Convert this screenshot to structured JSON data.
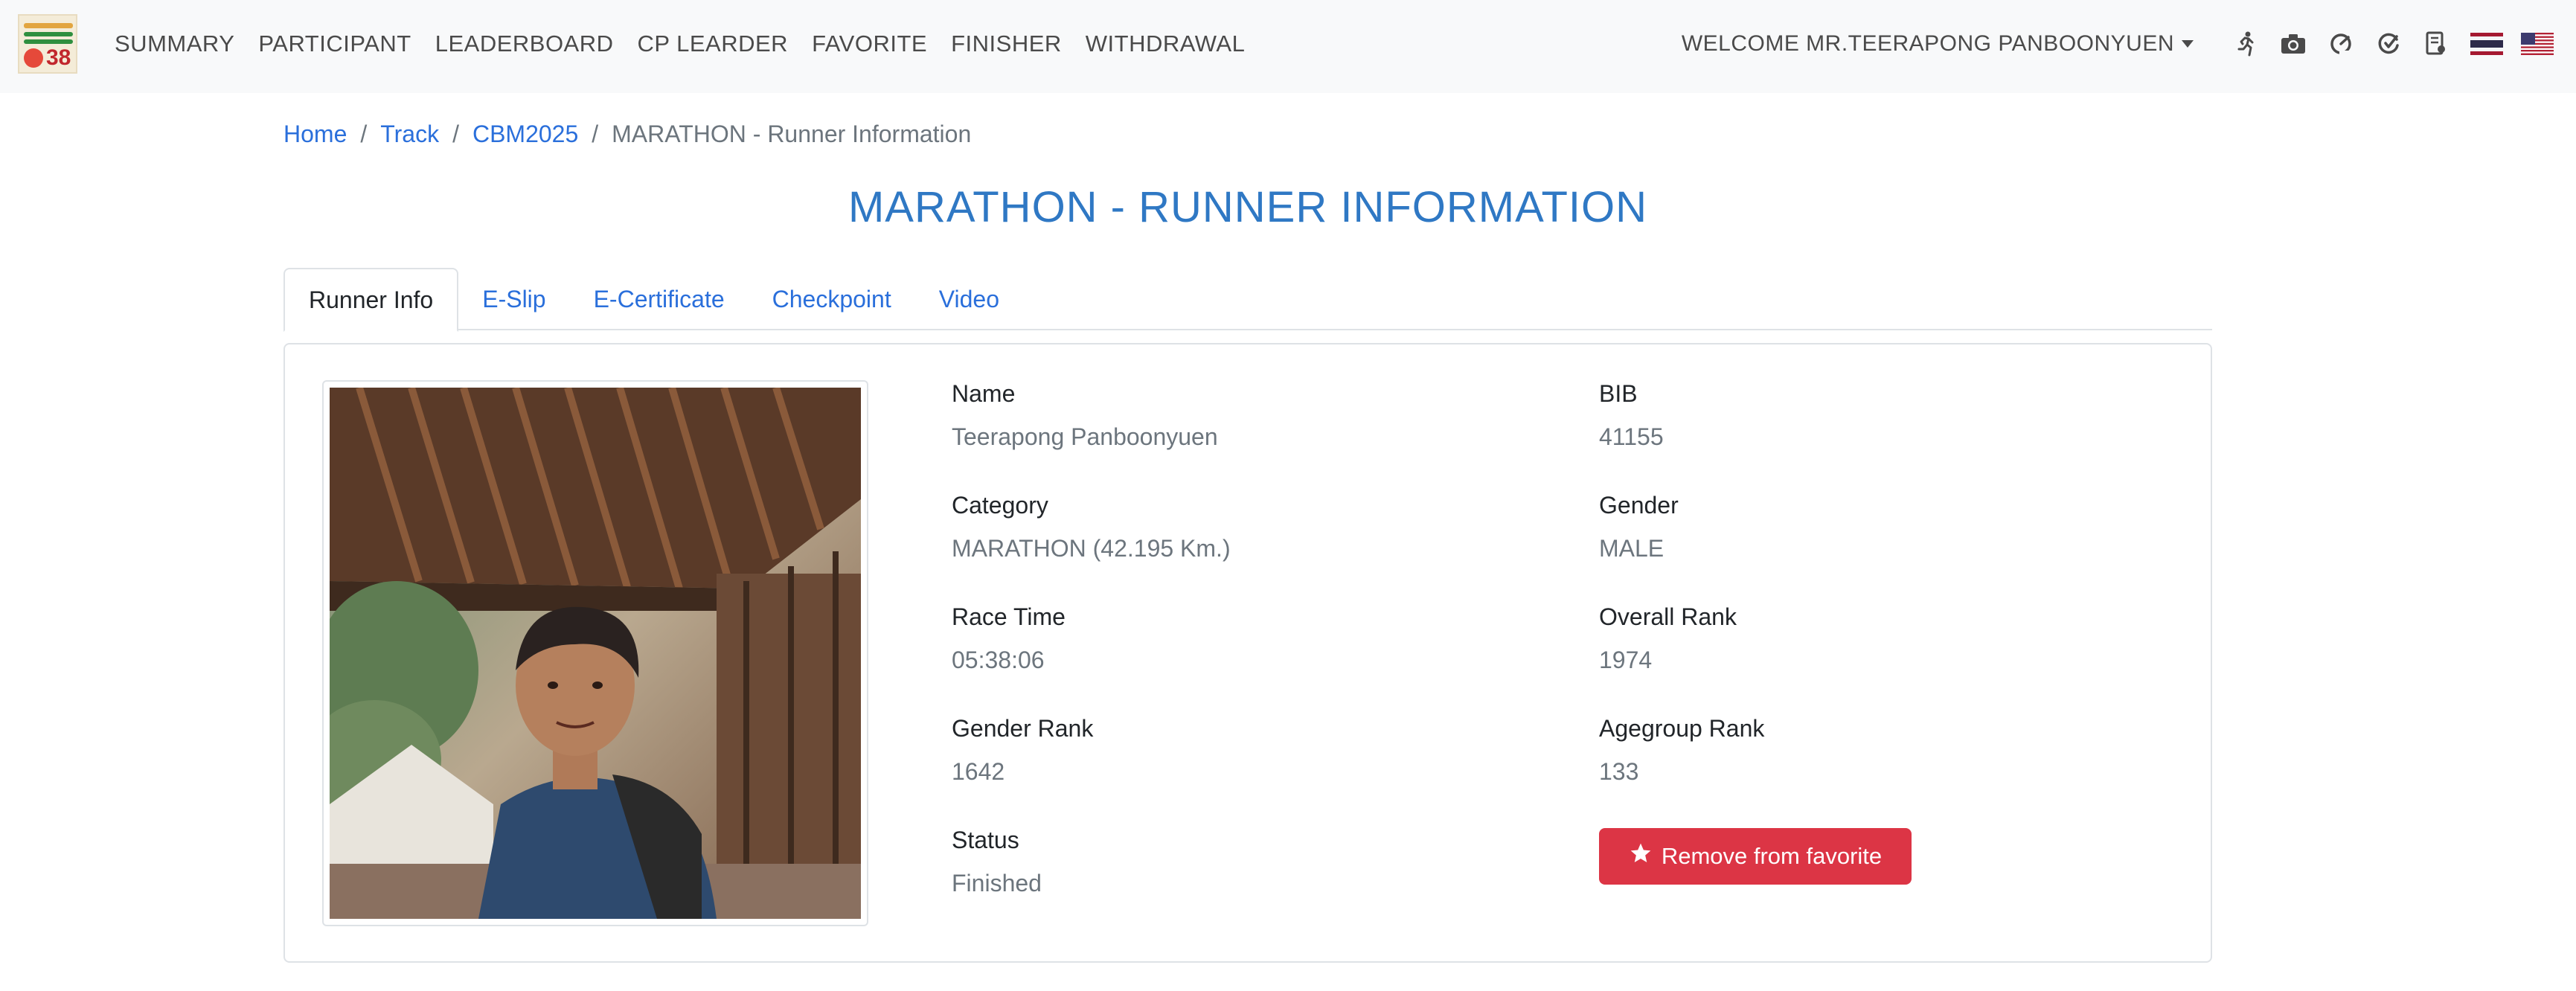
{
  "navbar": {
    "logo_icon": "event-logo",
    "logo_text": "38",
    "menu": [
      {
        "label": "SUMMARY"
      },
      {
        "label": "PARTICIPANT"
      },
      {
        "label": "LEADERBOARD"
      },
      {
        "label": "CP LEARDER"
      },
      {
        "label": "FAVORITE"
      },
      {
        "label": "FINISHER"
      },
      {
        "label": "WITHDRAWAL"
      }
    ],
    "welcome": "WELCOME MR.TEERAPONG PANBOONYUEN",
    "icons": [
      "runner-icon",
      "camera-icon",
      "speedometer-icon",
      "check-gauge-icon",
      "certificate-icon",
      "thai-flag-icon",
      "us-flag-icon"
    ]
  },
  "breadcrumb": {
    "items": [
      "Home",
      "Track",
      "CBM2025"
    ],
    "active": "MARATHON - Runner Information"
  },
  "page_title": "MARATHON - RUNNER INFORMATION",
  "tabs": [
    {
      "label": "Runner Info",
      "active": true
    },
    {
      "label": "E-Slip",
      "active": false
    },
    {
      "label": "E-Certificate",
      "active": false
    },
    {
      "label": "Checkpoint",
      "active": false
    },
    {
      "label": "Video",
      "active": false
    }
  ],
  "runner": {
    "photo_icon": "runner-photo",
    "fields": {
      "name": {
        "label": "Name",
        "value": "Teerapong Panboonyuen"
      },
      "bib": {
        "label": "BIB",
        "value": "41155"
      },
      "category": {
        "label": "Category",
        "value": "MARATHON (42.195 Km.)"
      },
      "gender": {
        "label": "Gender",
        "value": "MALE"
      },
      "race_time": {
        "label": "Race Time",
        "value": "05:38:06"
      },
      "overall_rank": {
        "label": "Overall Rank",
        "value": "1974"
      },
      "gender_rank": {
        "label": "Gender Rank",
        "value": "1642"
      },
      "agegroup_rank": {
        "label": "Agegroup Rank",
        "value": "133"
      },
      "status": {
        "label": "Status",
        "value": "Finished"
      }
    },
    "favorite_button": {
      "label": "Remove from favorite",
      "icon": "star-icon"
    }
  },
  "colors": {
    "link": "#2a6fdb",
    "title": "#2f78c4",
    "danger": "#dc3545",
    "navbar_bg": "#f8f9fa"
  }
}
